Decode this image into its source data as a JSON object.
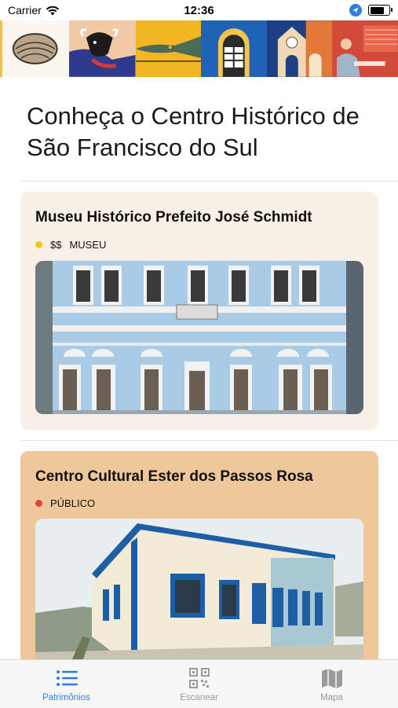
{
  "status_bar": {
    "carrier": "Carrier",
    "time": "12:36",
    "battery_level": 0.85
  },
  "banner": {
    "tiles": [
      "shell",
      "bull",
      "fish",
      "window",
      "tower",
      "weaver"
    ]
  },
  "header": {
    "title": "Conheça o Centro Histórico de São Francisco do Sul"
  },
  "places": [
    {
      "name": "Museu Histórico Prefeito José Schmidt",
      "price": "$$",
      "category": "MUSEU",
      "status_color": "#f5c518",
      "card_color": "#f8f0e6"
    },
    {
      "name": "Centro Cultural Ester dos Passos Rosa",
      "price": "",
      "category": "PÚBLICO",
      "status_color": "#e8423a",
      "card_color": "#eec79b"
    }
  ],
  "tabbar": {
    "tabs": [
      {
        "label": "Patrimônios",
        "icon": "list-icon",
        "active": true
      },
      {
        "label": "Escanear",
        "icon": "qr-code-icon",
        "active": false
      },
      {
        "label": "Mapa",
        "icon": "map-icon",
        "active": false
      }
    ]
  },
  "colors": {
    "accent": "#2f7de0",
    "inactive": "#9a9a9a"
  }
}
